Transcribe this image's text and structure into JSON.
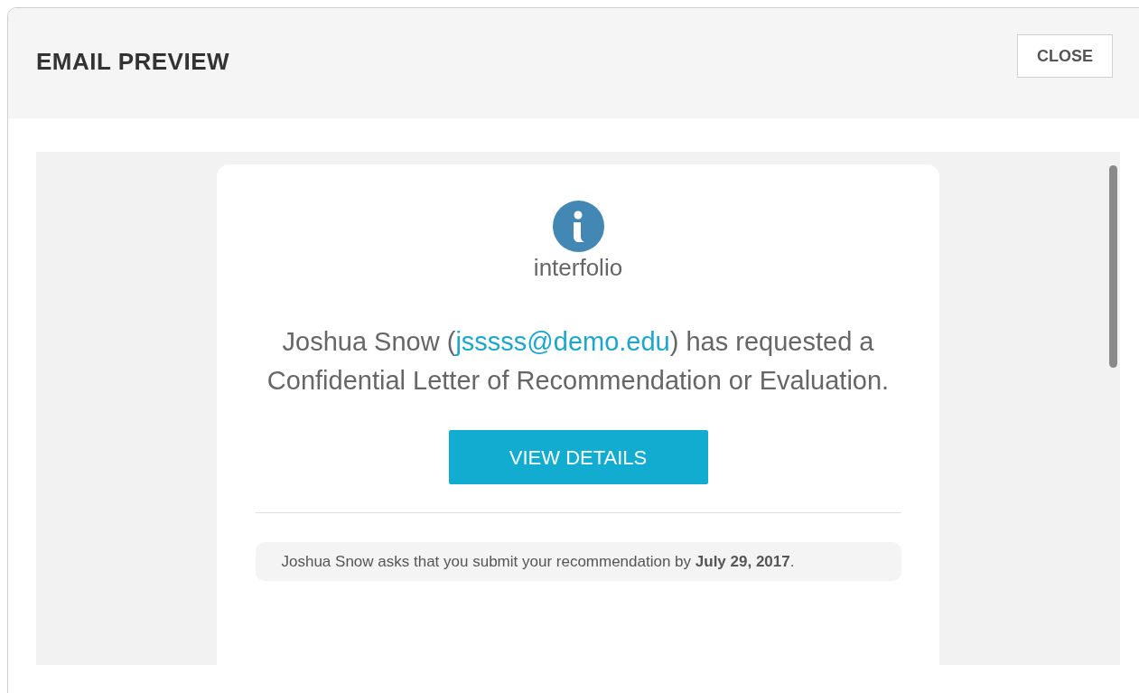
{
  "modal": {
    "title": "EMAIL PREVIEW",
    "close_label": "CLOSE"
  },
  "email": {
    "brand": "interfolio",
    "message": {
      "before": "Joshua Snow (",
      "link": "jsssss@demo.edu",
      "after": ") has requested a Confidential Letter of Recommendation or Evaluation."
    },
    "button": "VIEW DETAILS",
    "note": "Joshua Snow asks that you submit your recommendation by **July 29, 2017**."
  }
}
